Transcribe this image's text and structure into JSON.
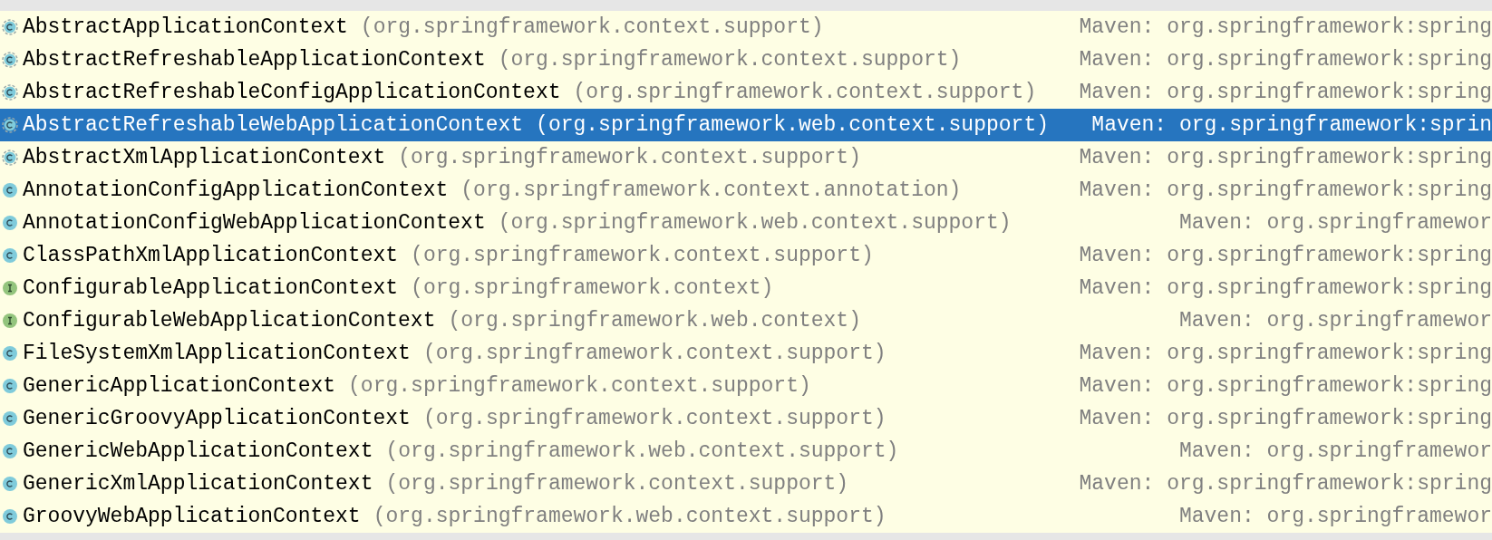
{
  "rows": [
    {
      "kind": "abstract_class",
      "name": "AbstractApplicationContext",
      "package": "(org.springframework.context.support)",
      "library": "Maven: org.springframework:spring",
      "selected": false
    },
    {
      "kind": "abstract_class",
      "name": "AbstractRefreshableApplicationContext",
      "package": "(org.springframework.context.support)",
      "library": "Maven: org.springframework:spring",
      "selected": false
    },
    {
      "kind": "abstract_class",
      "name": "AbstractRefreshableConfigApplicationContext",
      "package": "(org.springframework.context.support)",
      "library": "Maven: org.springframework:spring",
      "selected": false
    },
    {
      "kind": "abstract_class",
      "name": "AbstractRefreshableWebApplicationContext",
      "package": "(org.springframework.web.context.support)",
      "library": "Maven: org.springframework:sprin",
      "selected": true
    },
    {
      "kind": "abstract_class",
      "name": "AbstractXmlApplicationContext",
      "package": "(org.springframework.context.support)",
      "library": "Maven: org.springframework:spring",
      "selected": false
    },
    {
      "kind": "class",
      "name": "AnnotationConfigApplicationContext",
      "package": "(org.springframework.context.annotation)",
      "library": "Maven: org.springframework:spring",
      "selected": false
    },
    {
      "kind": "class",
      "name": "AnnotationConfigWebApplicationContext",
      "package": "(org.springframework.web.context.support)",
      "library": "Maven: org.springframewor",
      "selected": false
    },
    {
      "kind": "class",
      "name": "ClassPathXmlApplicationContext",
      "package": "(org.springframework.context.support)",
      "library": "Maven: org.springframework:spring",
      "selected": false
    },
    {
      "kind": "interface",
      "name": "ConfigurableApplicationContext",
      "package": "(org.springframework.context)",
      "library": "Maven: org.springframework:spring",
      "selected": false
    },
    {
      "kind": "interface",
      "name": "ConfigurableWebApplicationContext",
      "package": "(org.springframework.web.context)",
      "library": "Maven: org.springframewor",
      "selected": false
    },
    {
      "kind": "class",
      "name": "FileSystemXmlApplicationContext",
      "package": "(org.springframework.context.support)",
      "library": "Maven: org.springframework:spring",
      "selected": false
    },
    {
      "kind": "class",
      "name": "GenericApplicationContext",
      "package": "(org.springframework.context.support)",
      "library": "Maven: org.springframework:spring",
      "selected": false
    },
    {
      "kind": "class",
      "name": "GenericGroovyApplicationContext",
      "package": "(org.springframework.context.support)",
      "library": "Maven: org.springframework:spring",
      "selected": false
    },
    {
      "kind": "class",
      "name": "GenericWebApplicationContext",
      "package": "(org.springframework.web.context.support)",
      "library": "Maven: org.springframewor",
      "selected": false
    },
    {
      "kind": "class",
      "name": "GenericXmlApplicationContext",
      "package": "(org.springframework.context.support)",
      "library": "Maven: org.springframework:spring",
      "selected": false
    },
    {
      "kind": "class",
      "name": "GroovyWebApplicationContext",
      "package": "(org.springframework.web.context.support)",
      "library": "Maven: org.springframewor",
      "selected": false
    }
  ]
}
